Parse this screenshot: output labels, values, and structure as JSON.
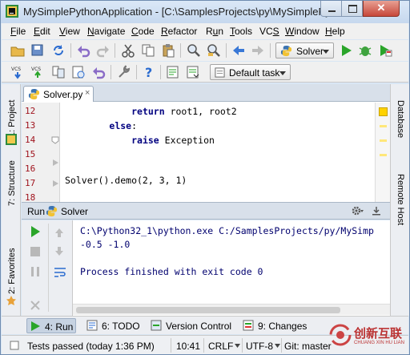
{
  "window": {
    "title": "MySimplePythonApplication - [C:\\SamplesProjects\\py\\MySimplePyt...",
    "close_glyph": "✕"
  },
  "menu": [
    {
      "label": "File",
      "key": "F"
    },
    {
      "label": "Edit",
      "key": "E"
    },
    {
      "label": "View",
      "key": "V"
    },
    {
      "label": "Navigate",
      "key": "N"
    },
    {
      "label": "Code",
      "key": "C"
    },
    {
      "label": "Refactor",
      "key": "R"
    },
    {
      "label": "Run",
      "key": "u"
    },
    {
      "label": "Tools",
      "key": "T"
    },
    {
      "label": "VCS",
      "key": "S"
    },
    {
      "label": "Window",
      "key": "W"
    },
    {
      "label": "Help",
      "key": "H"
    }
  ],
  "toolbar": {
    "run_config": "Solver",
    "task_selector": "Default task",
    "vcs_label": "VCS"
  },
  "side_tabs": {
    "project": "1: Project",
    "structure": "7: Structure",
    "favorites": "2: Favorites",
    "database": "Database",
    "remote_host": "Remote Host"
  },
  "editor": {
    "tab_label": "Solver.py",
    "close_glyph": "×",
    "line_numbers": [
      "12",
      "13",
      "14",
      "15",
      "16",
      "17",
      "18"
    ],
    "lines": [
      {
        "indent": "            ",
        "kw": "return",
        "rest": " root1, root2"
      },
      {
        "indent": "        ",
        "kw": "else",
        "rest": ":"
      },
      {
        "indent": "            ",
        "kw": "raise",
        "rest": " Exception"
      },
      {
        "indent": "",
        "kw": "",
        "rest": ""
      },
      {
        "indent": "",
        "kw": "",
        "rest": ""
      },
      {
        "indent": "",
        "kw": "",
        "rest": "Solver().demo(2, 3, 1)"
      },
      {
        "indent": "",
        "kw": "",
        "rest": ""
      }
    ]
  },
  "run_panel": {
    "title": "Run",
    "config": "Solver",
    "console": [
      "C:\\Python32_1\\python.exe C:/SamplesProjects/py/MySimp",
      "-0.5 -1.0",
      "",
      "Process finished with exit code 0"
    ]
  },
  "bottom_tools": [
    {
      "label": "4: Run",
      "key": "4"
    },
    {
      "label": "6: TODO",
      "key": "6"
    },
    {
      "label": "Version Control",
      "key": ""
    },
    {
      "label": "9: Changes",
      "key": "9"
    }
  ],
  "status": {
    "message": "Tests passed (today 1:36 PM)",
    "position": "10:41",
    "line_sep": "CRLF",
    "encoding": "UTF-8",
    "vcs_branch": "Git: master"
  },
  "watermark": {
    "title": "创新互联",
    "subtitle": "CHUANG XIN HU LIAN"
  },
  "colors": {
    "accent_run": "#2aa52a",
    "line_number": "#a0141e",
    "keyword": "#000080",
    "console_text": "#00006e"
  }
}
